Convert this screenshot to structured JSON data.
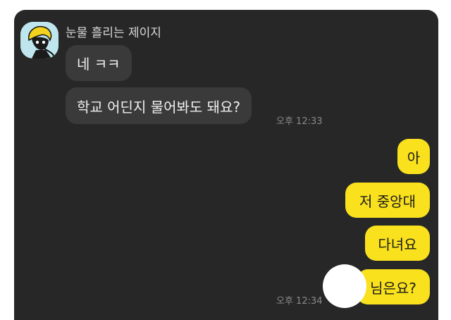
{
  "chat": {
    "sender_name": "눈물 흘리는 제이지",
    "incoming": [
      {
        "text": "네 ㅋㅋ"
      },
      {
        "text": "학교 어딘지 물어봐도 돼요?",
        "time": "오후 12:33"
      }
    ],
    "outgoing": [
      {
        "text": "아"
      },
      {
        "text": "저 중앙대"
      },
      {
        "text": "다녀요"
      },
      {
        "text": "님은요?",
        "time": "오후 12:34"
      }
    ]
  },
  "colors": {
    "background": "#272727",
    "incoming_bubble": "#3a3a3a",
    "outgoing_bubble": "#f9e11e"
  }
}
